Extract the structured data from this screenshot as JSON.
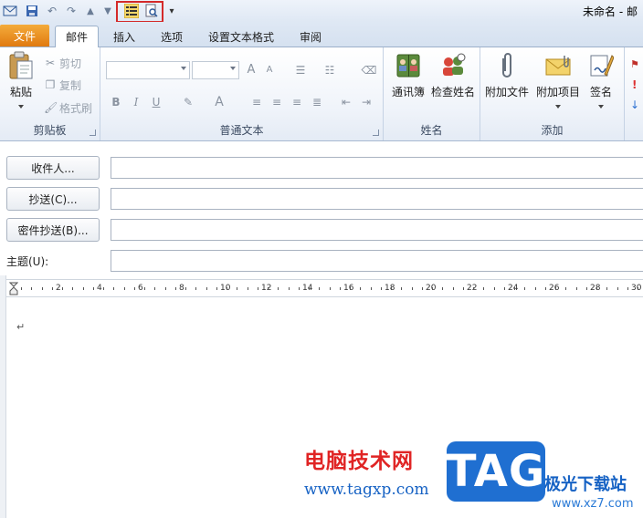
{
  "window": {
    "title": "未命名 - 邮"
  },
  "tabs": [
    {
      "label": "文件"
    },
    {
      "label": "邮件"
    },
    {
      "label": "插入"
    },
    {
      "label": "选项"
    },
    {
      "label": "设置文本格式"
    },
    {
      "label": "审阅"
    }
  ],
  "ribbon": {
    "clipboard": {
      "group_label": "剪贴板",
      "paste": "粘贴",
      "cut": "剪切",
      "copy": "复制",
      "format_painter": "格式刷"
    },
    "basic_text": {
      "group_label": "普通文本",
      "bold": "B",
      "italic": "I",
      "underline": "U",
      "font_color": "A",
      "grow_font": "A",
      "shrink_font": "A"
    },
    "names": {
      "group_label": "姓名",
      "address_book": "通讯簿",
      "check_names": "检查姓名"
    },
    "include": {
      "group_label": "添加",
      "attach_file": "附加文件",
      "attach_item": "附加项目",
      "signature": "签名"
    }
  },
  "header": {
    "to_button": "收件人...",
    "cc_button": "抄送(C)...",
    "bcc_button": "密件抄送(B)...",
    "subject_label": "主题(U):",
    "to_value": "",
    "cc_value": "",
    "bcc_value": "",
    "subject_value": ""
  },
  "ruler": {
    "labels": [
      "2",
      "4",
      "6",
      "8",
      "10",
      "12",
      "14",
      "16",
      "18",
      "20",
      "22",
      "24",
      "26",
      "28",
      "30"
    ]
  },
  "body": {
    "paragraph_mark": "↵"
  },
  "watermark": {
    "site_name": "电脑技术网",
    "site_url": "www.tagxp.com",
    "tag": "TAG",
    "partner_name": "极光下载站",
    "partner_url": "www.xz7.com"
  },
  "colors": {
    "file_tab": "#e07a10",
    "highlight_box": "#d42a2a",
    "watermark_red": "#e02424",
    "watermark_blue": "#1f6fd1"
  }
}
